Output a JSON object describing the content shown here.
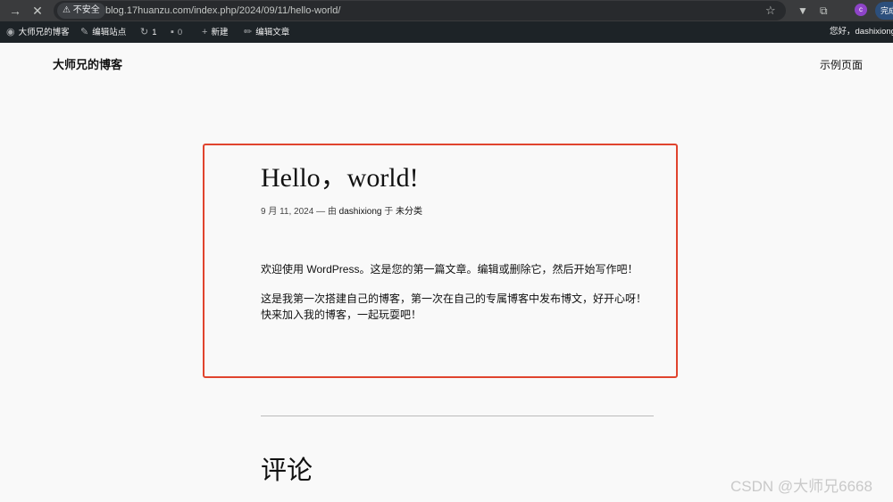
{
  "browser": {
    "back_glyph": "→",
    "stop_glyph": "✕",
    "insecure_label": "不安全",
    "url": "blog.17huanzu.com/index.php/2024/09/11/hello-world/",
    "profile_initial": "c",
    "done_label": "完成"
  },
  "admin_bar": {
    "site_name": "大师兄的博客",
    "customize": "编辑站点",
    "updates_count": "1",
    "comments_count": "0",
    "new_label": "新建",
    "edit_post": "编辑文章",
    "greeting": "您好，dashixiong"
  },
  "site": {
    "title": "大师兄的博客",
    "nav_link": "示例页面"
  },
  "post": {
    "title": "Hello，world!",
    "date": "9 月 11, 2024",
    "by": "— 由",
    "author": "dashixiong",
    "in": "于",
    "category": "未分类",
    "paragraphs": [
      "欢迎使用 WordPress。这是您的第一篇文章。编辑或删除它，然后开始写作吧！",
      "这是我第一次搭建自己的博客，第一次在自己的专属博客中发布博文，好开心呀！",
      "快来加入我的博客，一起玩耍吧！"
    ]
  },
  "comments": {
    "heading": "评论"
  },
  "watermark": "CSDN @大师兄6668",
  "colors": {
    "highlight_border": "#e0442e",
    "admin_bar_bg": "#1d2327"
  }
}
